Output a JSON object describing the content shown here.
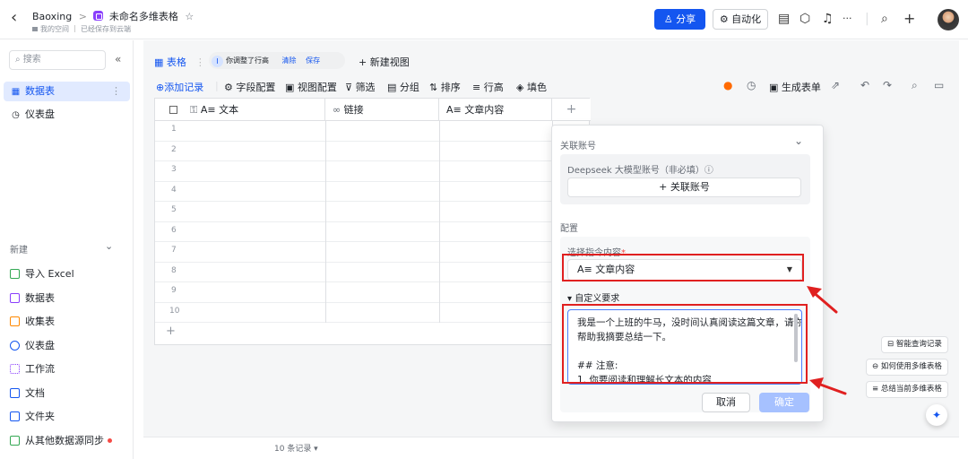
{
  "header": {
    "back_label": "‹",
    "breadcrumb_root": "Baoxing",
    "breadcrumb_sep": ">",
    "title": "未命名多维表格",
    "star": "☆",
    "space": "我的空间",
    "saved_status": "已经保存到云端",
    "share_label": "分享",
    "automation_label": "自动化",
    "more_label": "···",
    "plus_label": "+"
  },
  "sidebar": {
    "search_placeholder": "搜索",
    "collapse_label": "«",
    "items": [
      {
        "label": "数据表",
        "active": true
      },
      {
        "label": "仪表盘",
        "active": false
      }
    ],
    "new_header": "新建",
    "new_items": [
      {
        "label": "导入 Excel",
        "color": "#34a853"
      },
      {
        "label": "数据表",
        "color": "#8a3ffc"
      },
      {
        "label": "收集表",
        "color": "#ff8800"
      },
      {
        "label": "仪表盘",
        "color": "#1456f0"
      },
      {
        "label": "工作流",
        "color": "#8a3ffc"
      },
      {
        "label": "文档",
        "color": "#1456f0"
      },
      {
        "label": "文件夹",
        "color": "#1456f0"
      },
      {
        "label": "从其他数据源同步",
        "color": "#34a853"
      }
    ]
  },
  "viewbar": {
    "table_tab": "表格",
    "notice": "你调整了行高",
    "clear_label": "清除",
    "save_label": "保存",
    "new_view": "+ 新建视图"
  },
  "toolbar": {
    "add_record": "添加记录",
    "field_config": "字段配置",
    "view_config": "视图配置",
    "filter": "筛选",
    "group": "分组",
    "sort": "排序",
    "row_height": "行高",
    "fill_color": "填色",
    "generate_form": "生成表单"
  },
  "grid": {
    "columns": [
      "A≡ 文本",
      "链接",
      "A≡ 文章内容"
    ],
    "add_column": "+",
    "rows": [
      "1",
      "2",
      "3",
      "4",
      "5",
      "6",
      "7",
      "8",
      "9",
      "10"
    ],
    "add_row": "+"
  },
  "footer": {
    "record_count": "10 条记录 ▾"
  },
  "panel": {
    "linked_account_title": "关联账号",
    "chevron": "⌄",
    "deepseek_label": "Deepseek 大模型账号（非必填）ⓘ",
    "link_account_button": "+ 关联账号",
    "config_title": "配置",
    "instruction_label": "选择指令内容",
    "required_star": "*",
    "instruction_value": "A≡ 文章内容",
    "custom_req_label": "▾ 自定义要求",
    "custom_req_lines": [
      "我是一个上班的牛马，没时间认真阅读这篇文章，请你",
      "帮助我摘要总结一下。",
      "",
      "## 注意:",
      "1. 你要阅读和理解长文本的内容"
    ],
    "cancel_label": "取消",
    "confirm_label": "确定"
  },
  "helpers": {
    "smart_query": "智能查询记录",
    "how_to_use": "如何使用多维表格",
    "summarize": "总结当前多维表格",
    "fab_icon": "✦"
  },
  "colors": {
    "accent": "#1456f0",
    "annotation": "#e02020"
  }
}
